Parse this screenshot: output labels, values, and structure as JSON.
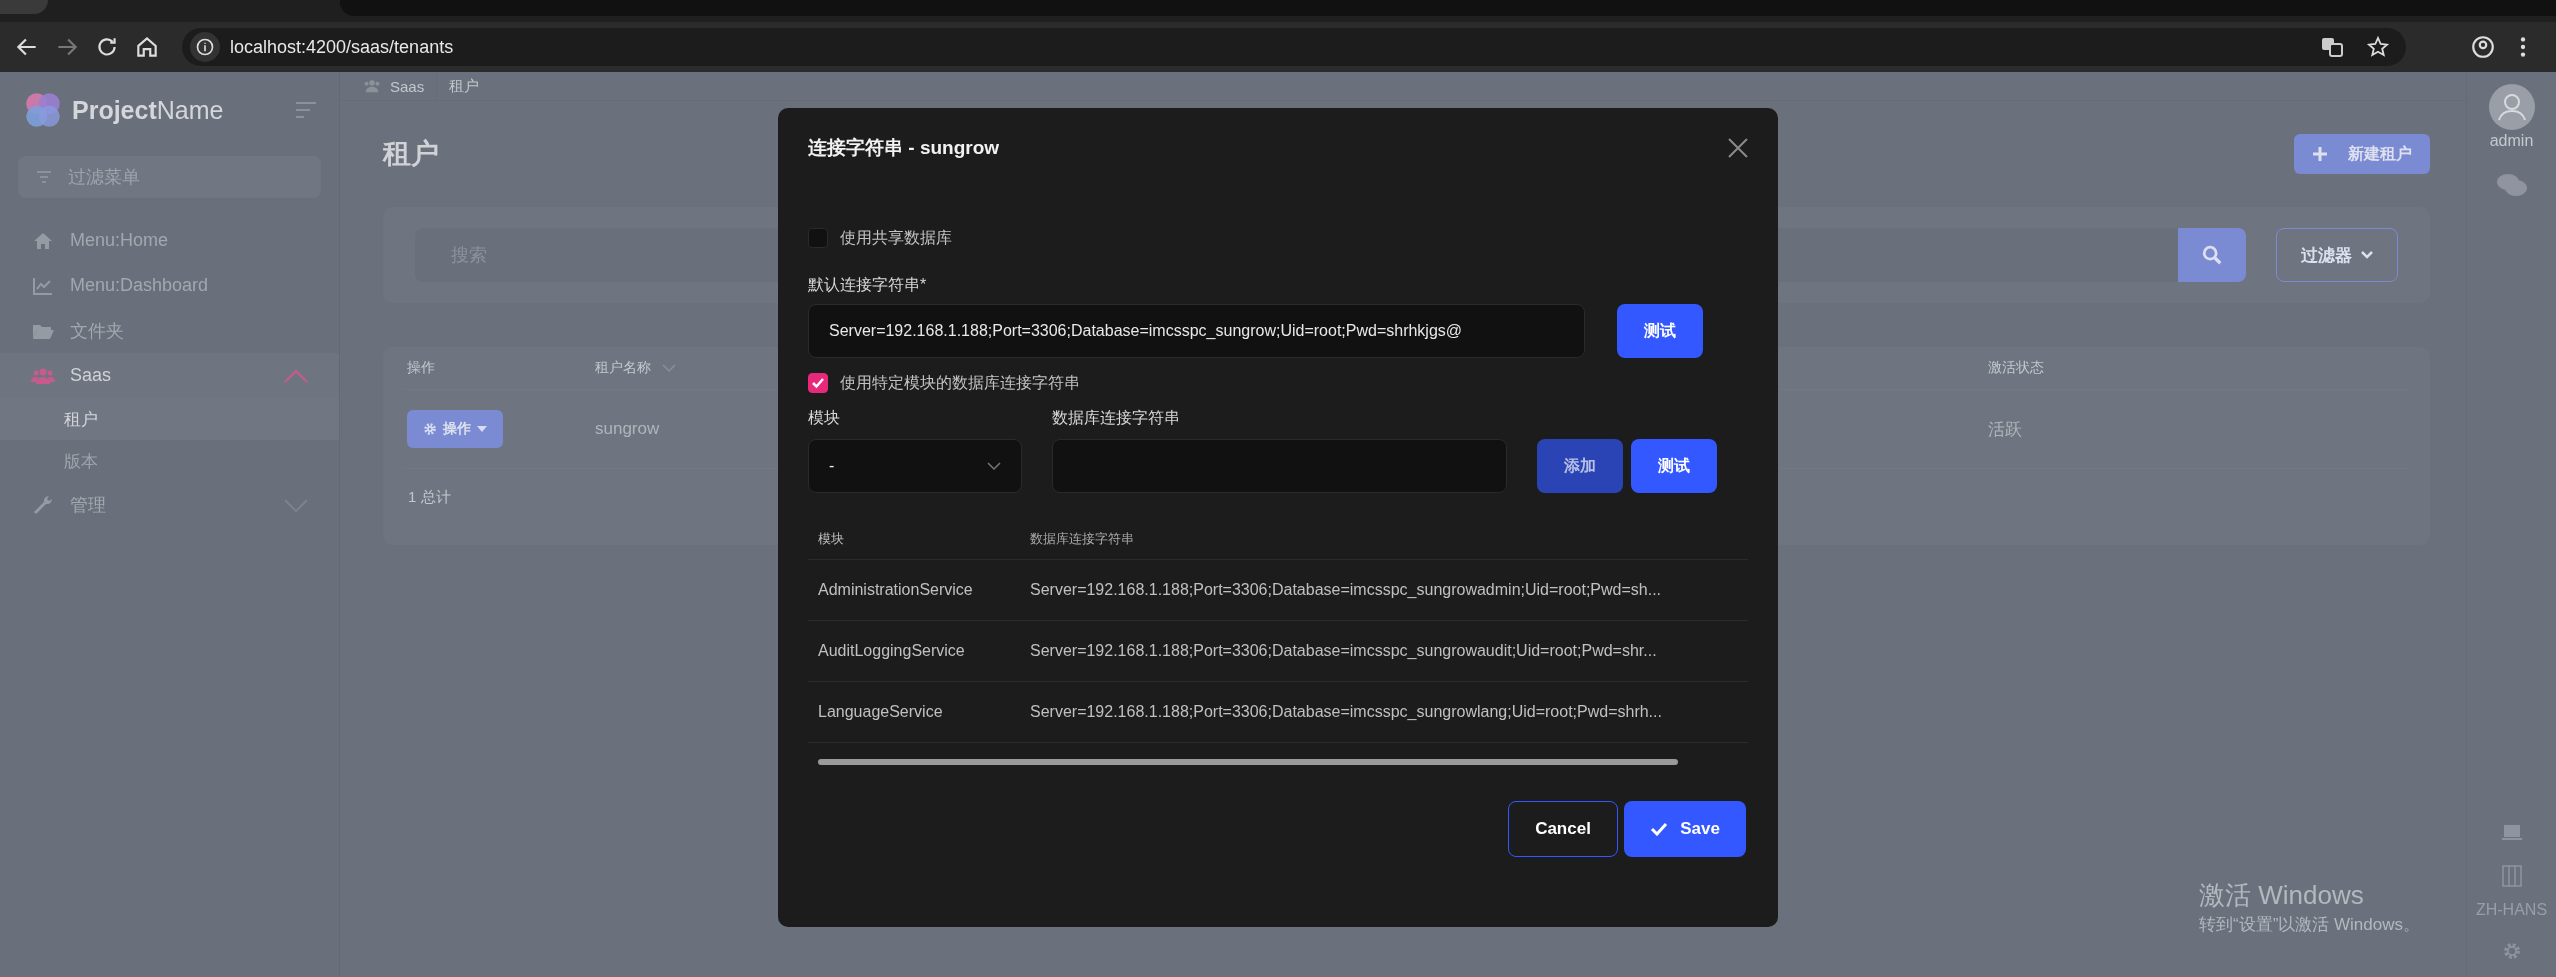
{
  "browser": {
    "url": "localhost:4200/saas/tenants"
  },
  "sidebar": {
    "brand": "**Project**Name",
    "filter_placeholder": "过滤菜单",
    "items": [
      {
        "label": "Menu:Home"
      },
      {
        "label": "Menu:Dashboard"
      },
      {
        "label": "文件夹"
      },
      {
        "label": "Saas",
        "expanded": true,
        "children": [
          {
            "label": "租户",
            "selected": true
          },
          {
            "label": "版本",
            "selected": false
          }
        ]
      },
      {
        "label": "管理",
        "expanded": false
      }
    ]
  },
  "breadcrumb": [
    "Saas",
    "租户"
  ],
  "page": {
    "title": "租户",
    "new_button": "新建租户",
    "search_placeholder": "搜索",
    "filter_button": "过滤器"
  },
  "table": {
    "columns": [
      "操作",
      "租户名称",
      "激活状态"
    ],
    "rows": [
      {
        "action": "操作",
        "name": "sungrow",
        "status": "活跃"
      }
    ],
    "total": "1 总计"
  },
  "user": {
    "name": "admin"
  },
  "language": "ZH-HANS",
  "modal": {
    "title": "连接字符串 - sungrow",
    "use_shared": {
      "label": "使用共享数据库",
      "checked": false
    },
    "default_label": "默认连接字符串*",
    "default_value": "Server=192.168.1.188;Port=3306;Database=imcsspc_sungrow;Uid=root;Pwd=shrhkjgs@",
    "test_button": "测试",
    "use_module": {
      "label": "使用特定模块的数据库连接字符串",
      "checked": true
    },
    "module_label": "模块",
    "module_value": "-",
    "conn_label": "数据库连接字符串",
    "add_button": "添加",
    "test_button_2": "测试",
    "table": {
      "columns": [
        "模块",
        "数据库连接字符串"
      ],
      "rows": [
        [
          "AdministrationService",
          "Server=192.168.1.188;Port=3306;Database=imcsspc_sungrowadmin;Uid=root;Pwd=sh..."
        ],
        [
          "AuditLoggingService",
          "Server=192.168.1.188;Port=3306;Database=imcsspc_sungrowaudit;Uid=root;Pwd=shr..."
        ],
        [
          "LanguageService",
          "Server=192.168.1.188;Port=3306;Database=imcsspc_sungrowlang;Uid=root;Pwd=shrh..."
        ]
      ]
    },
    "cancel": "Cancel",
    "save": "Save"
  },
  "watermark": {
    "title": "激活 Windows",
    "subtitle": "转到“设置”以激活 Windows。"
  }
}
